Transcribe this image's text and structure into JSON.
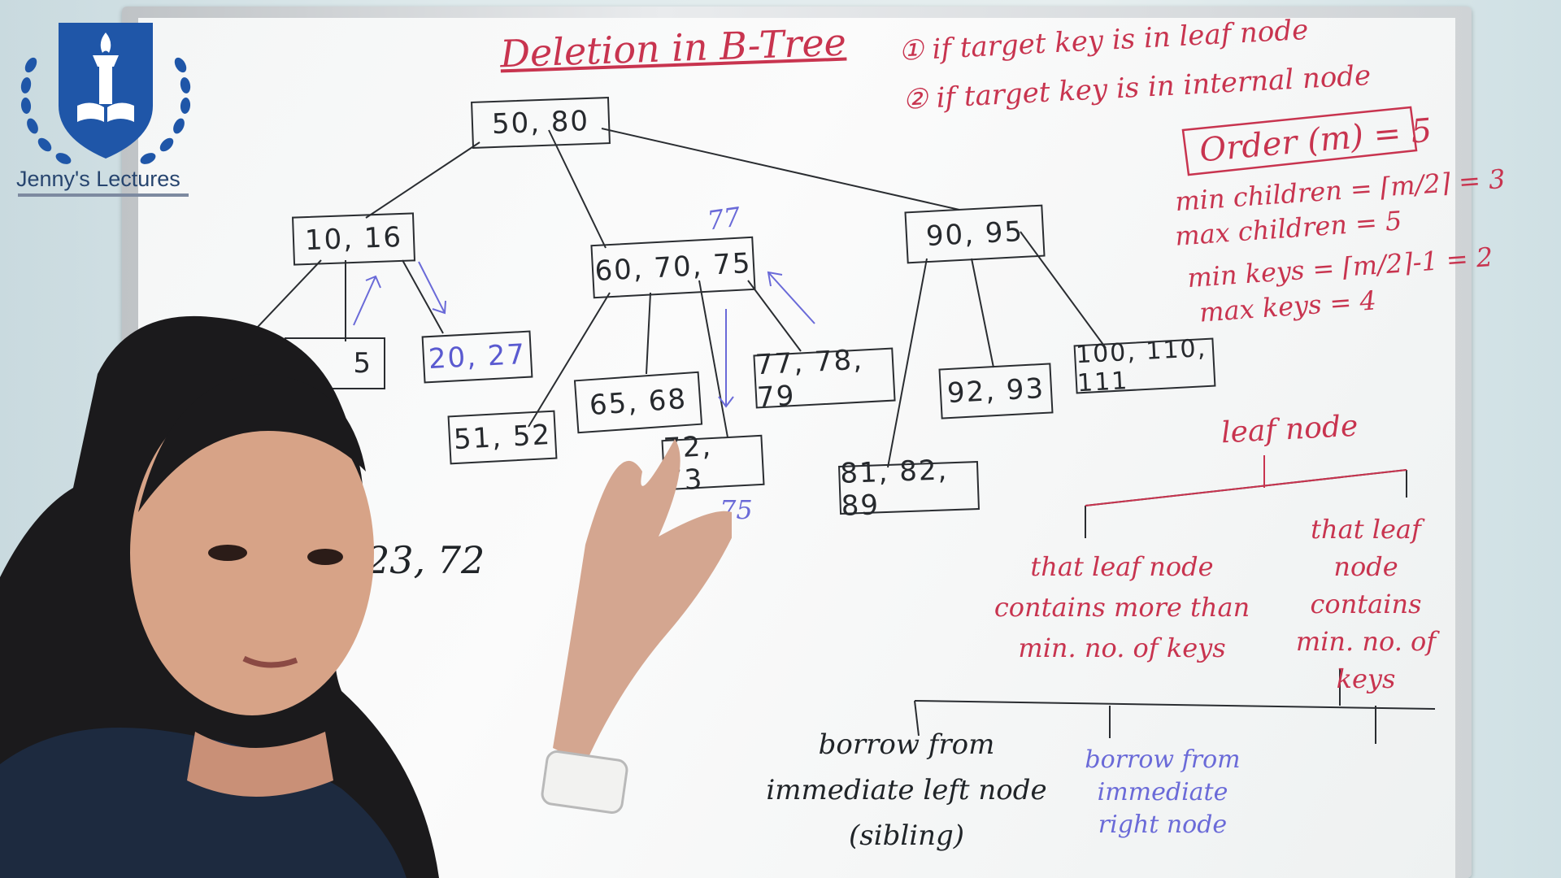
{
  "logo": {
    "brand_text": "Jenny's Lectures",
    "icon": "shield-laurel-torch-book-icon",
    "color": "#1f56a8"
  },
  "board": {
    "title": "Deletion in B-Tree",
    "cases": [
      "① if target key is in leaf node",
      "② if target key is in internal node"
    ],
    "order_box": "Order (m) = 5",
    "rules": [
      "min children = ⌈m/2⌉ = 3",
      "max children = 5",
      "min keys = ⌈m/2⌉-1 = 2",
      "max keys = 4"
    ],
    "tree": {
      "root": "50, 80",
      "level1": [
        "10, 16",
        "60, 70, 75",
        "90, 95"
      ],
      "leaves": [
        "5",
        "20, 27",
        "51, 52",
        "65, 68",
        "72, 73",
        "77, 78, 79",
        "81, 82, 89",
        "92, 93",
        "100, 110, 111"
      ]
    },
    "annotations": {
      "blue_77": "77",
      "blue_75": "75",
      "deleted_keys": "23, 72"
    },
    "leaf_node_heading": "leaf node",
    "branch_left": "that leaf node contains more than min. no. of keys",
    "branch_right": "that leaf node contains min. no. of keys",
    "borrow_left": "borrow from immediate left node (sibling)",
    "borrow_right": "borrow from immediate right node"
  }
}
